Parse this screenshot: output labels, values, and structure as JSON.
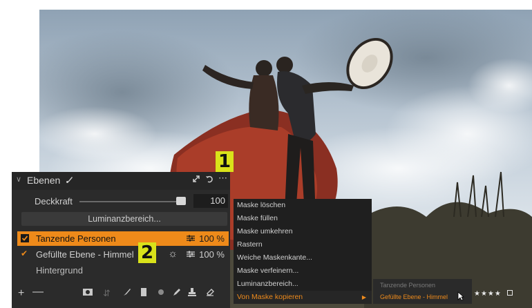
{
  "callouts": [
    "1",
    "2"
  ],
  "layers_panel": {
    "title": "Ebenen",
    "opacity_label": "Deckkraft",
    "opacity_value": "100",
    "opacity_level": 1.0,
    "luminance_button": "Luminanzbereich...",
    "layers": [
      {
        "name": "Tanzende Personen",
        "percent": "100 %",
        "selected": true,
        "checked": true
      },
      {
        "name": "Gefüllte Ebene - Himmel",
        "percent": "100 %",
        "selected": false,
        "checked": true
      },
      {
        "name": "Hintergrund",
        "percent": "",
        "selected": false,
        "checked": false
      }
    ],
    "accent_color": "#ee8a1a"
  },
  "context_menu": {
    "items": [
      "Maske löschen",
      "Maske füllen",
      "Maske umkehren",
      "Rastern",
      "Weiche Maskenkante...",
      "Maske verfeinern...",
      "Luminanzbereich...",
      "Von Maske kopieren"
    ],
    "highlighted": "Von Maske kopieren",
    "submenu": [
      "Tanzende Personen",
      "Gefüllte Ebene - Himmel"
    ]
  },
  "rating": "★★★★"
}
